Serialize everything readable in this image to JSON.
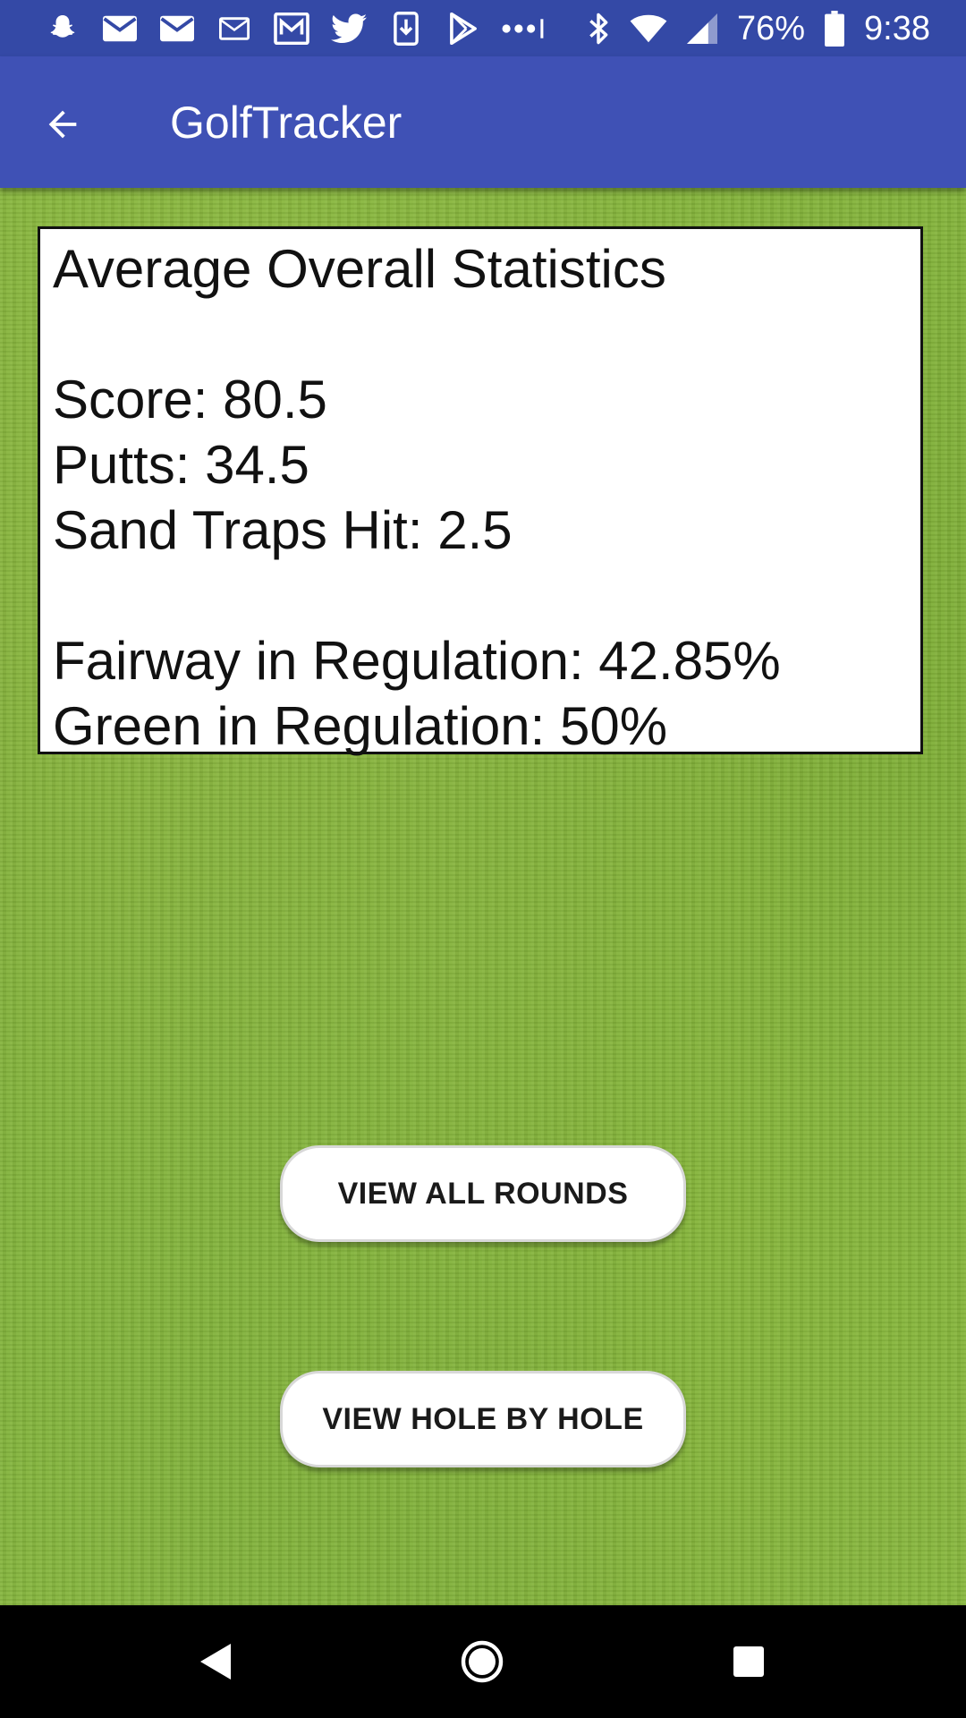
{
  "status_bar": {
    "left_icons": [
      "snapchat-icon",
      "gmail-icon",
      "gmail-icon",
      "mail-icon",
      "inbox-icon",
      "twitter-icon",
      "download-icon",
      "play-store-icon",
      "more-dots-icon"
    ],
    "battery_percent": "76%",
    "time": "9:38"
  },
  "app_bar": {
    "title": "GolfTracker"
  },
  "stats": {
    "heading": "Average Overall Statistics",
    "score": "Score: 80.5",
    "putts": "Putts: 34.5",
    "sand_traps": "Sand Traps Hit: 2.5",
    "fairway": "Fairway in Regulation: 42.85%",
    "green": "Green in Regulation: 50%"
  },
  "buttons": {
    "view_all_rounds": "VIEW ALL ROUNDS",
    "view_hole_by_hole": "VIEW HOLE BY HOLE"
  },
  "colors": {
    "status_bar": "#3449a6",
    "app_bar": "#3f51b5",
    "grass": "#7fae36",
    "nav_bar": "#000000"
  }
}
